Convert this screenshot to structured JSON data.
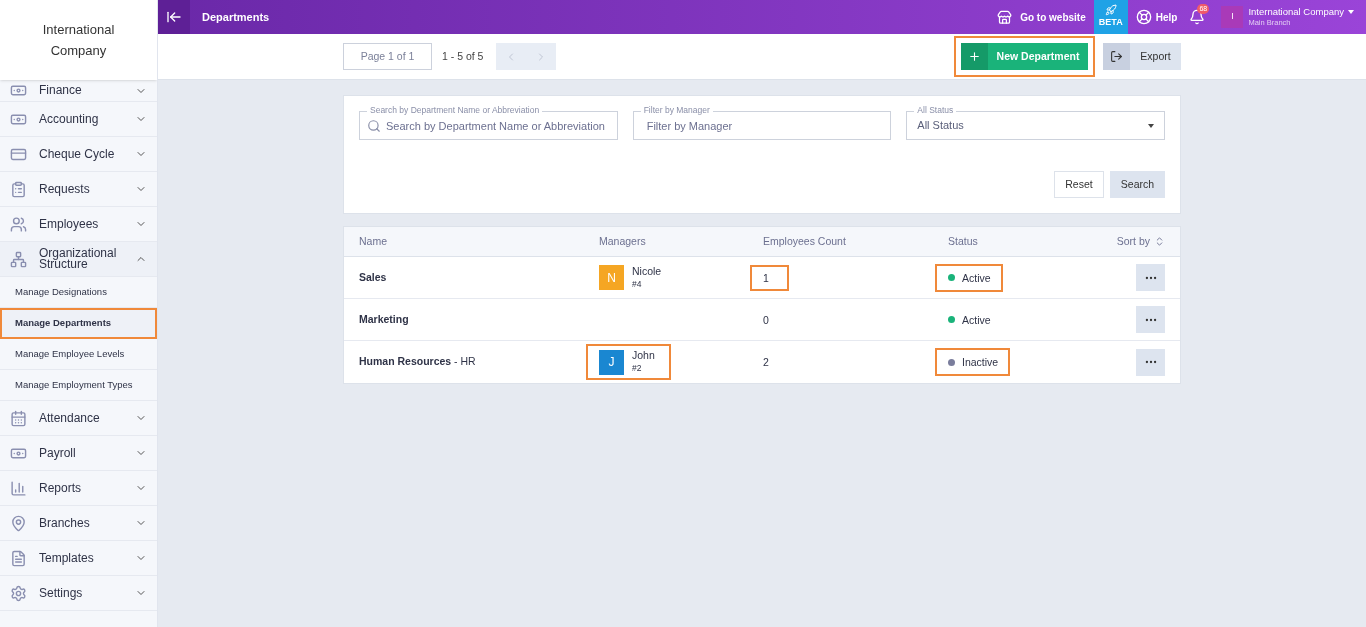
{
  "sidebar": {
    "company": "International Company",
    "items": [
      {
        "label": "Finance",
        "expanded": false
      },
      {
        "label": "Accounting",
        "expanded": false
      },
      {
        "label": "Cheque Cycle",
        "expanded": false
      },
      {
        "label": "Requests",
        "expanded": false
      },
      {
        "label": "Employees",
        "expanded": false
      },
      {
        "label": "Organizational Structure",
        "expanded": true,
        "children": [
          {
            "label": "Manage Designations",
            "selected": false,
            "highlighted": false
          },
          {
            "label": "Manage Departments",
            "selected": true,
            "highlighted": true
          },
          {
            "label": "Manage Employee Levels",
            "selected": false,
            "highlighted": false
          },
          {
            "label": "Manage Employment Types",
            "selected": false,
            "highlighted": false
          }
        ]
      },
      {
        "label": "Attendance",
        "expanded": false
      },
      {
        "label": "Payroll",
        "expanded": false
      },
      {
        "label": "Reports",
        "expanded": false
      },
      {
        "label": "Branches",
        "expanded": false
      },
      {
        "label": "Templates",
        "expanded": false
      },
      {
        "label": "Settings",
        "expanded": false
      }
    ]
  },
  "topbar": {
    "title": "Departments",
    "website": "Go to website",
    "beta": "BETA",
    "help": "Help",
    "notifications": "68",
    "account": {
      "initial": "I",
      "name": "International Company",
      "branch": "Main Branch"
    }
  },
  "toolbar": {
    "page": "Page 1 of 1",
    "range": "1 - 5 of 5",
    "prev_disabled": true,
    "next_disabled": true,
    "new_button": {
      "label": "New Department",
      "highlighted": true
    },
    "export_button": {
      "label": "Export"
    }
  },
  "filters": [
    {
      "kind": "search",
      "label": "Search by Department Name or Abbreviation",
      "placeholder": "Search by Department Name or Abbreviation"
    },
    {
      "kind": "text",
      "label": "Filter by Manager",
      "placeholder": "Filter by Manager"
    },
    {
      "kind": "select",
      "label": "All Status",
      "value": "All Status"
    }
  ],
  "filter_buttons": {
    "reset": "Reset",
    "search": "Search"
  },
  "table": {
    "columns": [
      "Name",
      "Managers",
      "Employees Count",
      "Status",
      "Sort by"
    ],
    "rows": [
      {
        "name": "**Sales**",
        "manager": {
          "initial": "N",
          "name": "Nicole",
          "code": "#4",
          "color": "#f5a623",
          "highlighted": false
        },
        "count": "1",
        "count_highlighted": true,
        "status": "Active",
        "active": true,
        "status_highlighted": true
      },
      {
        "name": "**Marketing**",
        "manager": null,
        "count": "0",
        "count_highlighted": false,
        "status": "Active",
        "active": true,
        "status_highlighted": false
      },
      {
        "name": "**Human Resources** - HR",
        "manager": {
          "initial": "J",
          "name": "John",
          "code": "#2",
          "color": "#1a87d1",
          "highlighted": true
        },
        "count": "2",
        "count_highlighted": false,
        "status": "Inactive",
        "active": false,
        "status_highlighted": true
      }
    ]
  }
}
